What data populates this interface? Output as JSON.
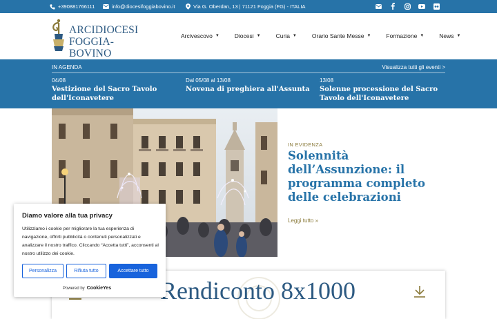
{
  "topbar": {
    "phone": "+390881766111",
    "email": "info@diocesifoggiabovino.it",
    "address": "Via G. Oberdan, 13 | 71121 Foggia (FG) - ITALIA",
    "socials": [
      "email-icon",
      "facebook-icon",
      "instagram-icon",
      "youtube-icon",
      "flickr-icon"
    ]
  },
  "logo": {
    "line1": "ARCIDIOCESI",
    "line2": "FOGGIA-BOVINO"
  },
  "nav": {
    "items": [
      {
        "label": "Arcivescovo"
      },
      {
        "label": "Diocesi"
      },
      {
        "label": "Curia"
      },
      {
        "label": "Orario Sante Messe"
      },
      {
        "label": "Formazione"
      },
      {
        "label": "News"
      }
    ]
  },
  "agenda": {
    "heading": "IN AGENDA",
    "view_all": "Visualizza tutti gli eventi >",
    "events": [
      {
        "date": "04/08",
        "title": "Vestizione del Sacro Tavolo dell'Iconavetere"
      },
      {
        "date": "Dal 05/08 al 13/08",
        "title": "Novena di preghiera all'Assunta"
      },
      {
        "date": "13/08",
        "title": "Solenne processione del Sacro Tavolo dell'Iconavetere"
      }
    ]
  },
  "feature": {
    "tag": "IN EVIDENZA",
    "title": "Solennità dell’Assunzione: il programma completo delle celebrazioni",
    "read_more": "Leggi tutto »"
  },
  "rendiconto": {
    "title": "Rendiconto 8x1000"
  },
  "cookie": {
    "title": "Diamo valore alla tua privacy",
    "text": "Utilizziamo i cookie per migliorare la tua esperienza di navigazione, offrirti pubblicità o contenuti personalizzati e analizzare il nostro traffico. Cliccando “Accetta tutti”, acconsenti al nostro utilizzo dei cookie.",
    "customize": "Personalizza",
    "reject": "Rifiuta tutto",
    "accept": "Accettare tutto",
    "powered_by": "Powered by",
    "brand": "CookieYes"
  },
  "colors": {
    "brand_blue": "#2773a8",
    "gold": "#8a7a3a",
    "cookie_blue": "#1863dc"
  }
}
